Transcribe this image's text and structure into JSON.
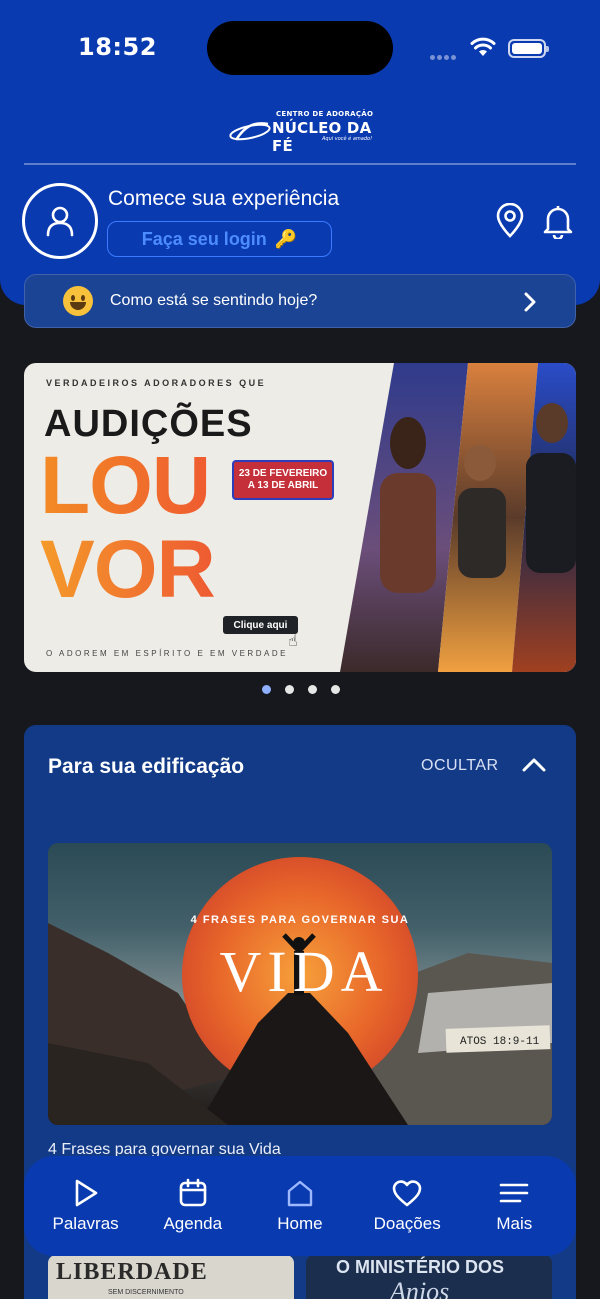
{
  "status_bar": {
    "time": "18:52"
  },
  "logo": {
    "top_line": "CENTRO DE ADORAÇÃO",
    "name": "NÚCLEO DA FÉ",
    "tagline": "Aqui você é amado!"
  },
  "header": {
    "welcome": "Comece sua experiência",
    "login_label": "Faça seu login",
    "login_emoji": "🔑"
  },
  "mood": {
    "question": "Como está se sentindo hoje?"
  },
  "banner": {
    "top_text": "VERDADEIROS ADORADORES QUE",
    "title_1": "AUDIÇÕES",
    "title_2": "LOU",
    "title_3": "VOR",
    "date_line_1": "23 DE FEVEREIRO",
    "date_line_2": "A 13 DE ABRIL",
    "cta": "Clique aqui",
    "bottom_text": "O ADOREM EM ESPÍRITO E EM VERDADE",
    "page_count": 4,
    "active_page": 1
  },
  "edification": {
    "title": "Para sua edificação",
    "hide_label": "OCULTAR",
    "post": {
      "arc_text": "4 FRASES PARA GOVERNAR SUA",
      "big_word": "VIDA",
      "verse": "ATOS 18:9-11",
      "caption": "4 Frases para governar sua Vida"
    },
    "thumb_1_title": "LIBERDADE",
    "thumb_1_sub": "SEM DISCERNIMENTO",
    "thumb_2_title": "O MINISTÉRIO DOS",
    "thumb_2_sub": "Anjos"
  },
  "tabs": [
    {
      "label": "Palavras",
      "icon": "play-icon"
    },
    {
      "label": "Agenda",
      "icon": "calendar-icon"
    },
    {
      "label": "Home",
      "icon": "home-icon"
    },
    {
      "label": "Doações",
      "icon": "heart-icon"
    },
    {
      "label": "Mais",
      "icon": "menu-icon"
    }
  ],
  "colors": {
    "primary_blue": "#0a3ab0",
    "card_blue": "#133a86",
    "background": "#16181d",
    "accent_link": "#4d8cff"
  }
}
